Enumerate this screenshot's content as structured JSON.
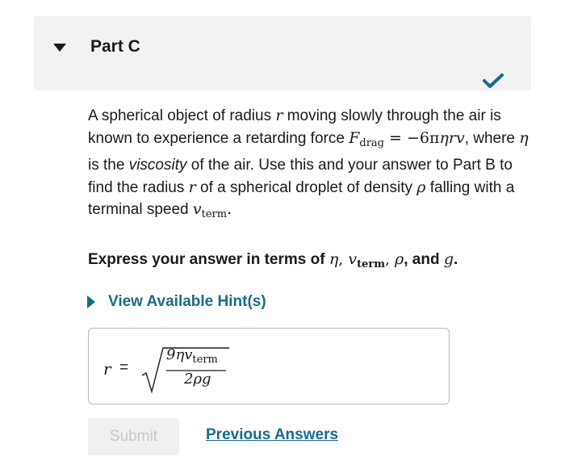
{
  "part": {
    "title": "Part C"
  },
  "question": {
    "t1": "A spherical object of radius ",
    "var_r": "r",
    "t2": " moving slowly through the air is known to experience a retarding force ",
    "f_main": "F",
    "f_sub": "drag",
    "f_eq": " = −6π",
    "f_vars": "ηrv",
    "t3": ", where ",
    "var_eta": "η",
    "t4": " is the ",
    "viscosity": "viscosity",
    "t5": " of the air. Use this and your answer to Part B to find the radius ",
    "var_r2": "r",
    "t6": " of a spherical droplet of density ",
    "var_rho": "ρ",
    "t7": " falling with a terminal speed ",
    "v_main": "v",
    "v_sub": "term",
    "t8": "."
  },
  "express": {
    "prefix": "Express your answer in terms of ",
    "eta": "η",
    "c1": ", ",
    "v": "v",
    "vsub": "term",
    "c2": ", ",
    "rho": "ρ",
    "c3": ", and ",
    "g": "g",
    "end": "."
  },
  "hint": {
    "label": "View Available Hint(s)"
  },
  "answer": {
    "var": "r",
    "eq": "=",
    "num_main": "9ηv",
    "num_sub": "term",
    "den": "2ρg"
  },
  "buttons": {
    "submit": "Submit",
    "previous": "Previous Answers"
  },
  "colors": {
    "link": "#1a6b8a",
    "check": "#1a6b8a",
    "header_bg": "#f2f2f2"
  },
  "icons": [
    "caret-down-icon",
    "checkmark-icon",
    "caret-right-icon"
  ]
}
